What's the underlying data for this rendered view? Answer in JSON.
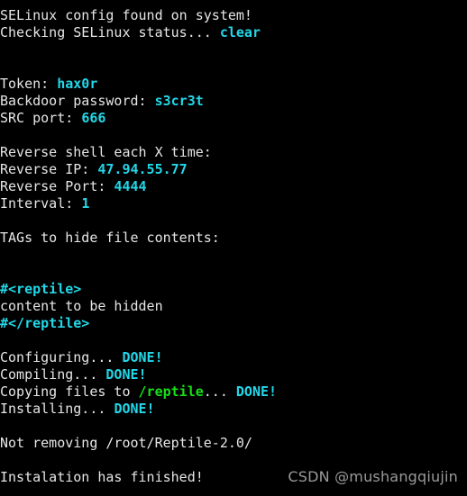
{
  "terminal": {
    "background_color": "#000000",
    "text_color": "#e6e6e6",
    "accent_cyan": "#23d7e8",
    "accent_green": "#16e016",
    "lines": [
      {
        "id": "selinux-found",
        "segments": [
          {
            "text": "SELinux config found on system!",
            "style": "plain"
          }
        ]
      },
      {
        "id": "selinux-status",
        "segments": [
          {
            "text": "Checking SELinux status... ",
            "style": "plain"
          },
          {
            "text": "clear",
            "style": "cyan"
          }
        ]
      },
      {
        "id": "blank-1",
        "segments": []
      },
      {
        "id": "blank-2",
        "segments": []
      },
      {
        "id": "token",
        "segments": [
          {
            "text": "Token: ",
            "style": "plain"
          },
          {
            "text": "hax0r",
            "style": "cyan"
          }
        ]
      },
      {
        "id": "backdoor-password",
        "segments": [
          {
            "text": "Backdoor password: ",
            "style": "plain"
          },
          {
            "text": "s3cr3t",
            "style": "cyan"
          }
        ]
      },
      {
        "id": "src-port",
        "segments": [
          {
            "text": "SRC port: ",
            "style": "plain"
          },
          {
            "text": "666",
            "style": "cyan"
          }
        ]
      },
      {
        "id": "blank-3",
        "segments": []
      },
      {
        "id": "reverse-shell-header",
        "segments": [
          {
            "text": "Reverse shell each X time:",
            "style": "plain"
          }
        ]
      },
      {
        "id": "reverse-ip",
        "segments": [
          {
            "text": "Reverse IP: ",
            "style": "plain"
          },
          {
            "text": "47.94.55.77",
            "style": "cyan"
          }
        ]
      },
      {
        "id": "reverse-port",
        "segments": [
          {
            "text": "Reverse Port: ",
            "style": "plain"
          },
          {
            "text": "4444",
            "style": "cyan"
          }
        ]
      },
      {
        "id": "interval",
        "segments": [
          {
            "text": "Interval: ",
            "style": "plain"
          },
          {
            "text": "1",
            "style": "cyan"
          }
        ]
      },
      {
        "id": "blank-4",
        "segments": []
      },
      {
        "id": "tags-header",
        "segments": [
          {
            "text": "TAGs to hide file contents:",
            "style": "plain"
          }
        ]
      },
      {
        "id": "blank-5",
        "segments": []
      },
      {
        "id": "blank-6",
        "segments": []
      },
      {
        "id": "tag-open",
        "segments": [
          {
            "text": "#<reptile>",
            "style": "cyan"
          }
        ]
      },
      {
        "id": "tag-content",
        "segments": [
          {
            "text": "content to be hidden",
            "style": "plain"
          }
        ]
      },
      {
        "id": "tag-close",
        "segments": [
          {
            "text": "#</reptile>",
            "style": "cyan"
          }
        ]
      },
      {
        "id": "blank-7",
        "segments": []
      },
      {
        "id": "configuring",
        "segments": [
          {
            "text": "Configuring... ",
            "style": "plain"
          },
          {
            "text": "DONE!",
            "style": "cyan"
          }
        ]
      },
      {
        "id": "compiling",
        "segments": [
          {
            "text": "Compiling... ",
            "style": "plain"
          },
          {
            "text": "DONE!",
            "style": "cyan"
          }
        ]
      },
      {
        "id": "copying-files",
        "segments": [
          {
            "text": "Copying files to ",
            "style": "plain"
          },
          {
            "text": "/reptile",
            "style": "green"
          },
          {
            "text": "... ",
            "style": "plain"
          },
          {
            "text": "DONE!",
            "style": "cyan"
          }
        ]
      },
      {
        "id": "installing",
        "segments": [
          {
            "text": "Installing... ",
            "style": "plain"
          },
          {
            "text": "DONE!",
            "style": "cyan"
          }
        ]
      },
      {
        "id": "blank-8",
        "segments": []
      },
      {
        "id": "not-removing",
        "segments": [
          {
            "text": "Not removing /root/Reptile-2.0/",
            "style": "plain"
          }
        ]
      },
      {
        "id": "blank-9",
        "segments": []
      },
      {
        "id": "installation-finished",
        "segments": [
          {
            "text": "Instalation has finished!",
            "style": "plain"
          }
        ]
      }
    ]
  },
  "watermark": {
    "text": "CSDN @mushangqiujin",
    "color": "#9a9a9a"
  }
}
